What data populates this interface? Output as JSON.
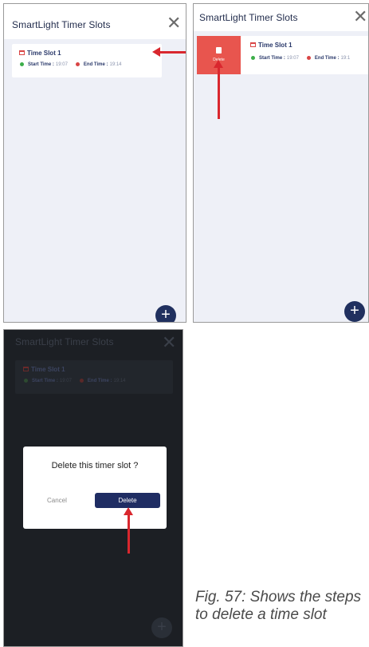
{
  "panel1": {
    "title": "SmartLight Timer Slots",
    "slot_title": "Time Slot 1",
    "start_label": "Start Time :",
    "start_value": "19:07",
    "end_label": "End Time :",
    "end_value": "19:14",
    "fab": "+"
  },
  "panel2": {
    "title": "SmartLight Timer Slots",
    "delete_label": "Delete",
    "slot_title": "Time Slot 1",
    "start_label": "Start Time :",
    "start_value": "19:07",
    "end_label": "End Time :",
    "end_value": "19:1",
    "fab": "+"
  },
  "panel3": {
    "title": "SmartLight Timer Slots",
    "slot_title": "Time Slot 1",
    "start_label": "Start Time :",
    "start_value": "19:07",
    "end_label": "End Time :",
    "end_value": "19:14",
    "dialog_question": "Delete this timer slot ?",
    "cancel_label": "Cancel",
    "delete_label": "Delete",
    "fab": "+"
  },
  "caption": "Fig. 57: Shows the steps to delete a time slot",
  "colors": {
    "accent": "#20305f",
    "delete": "#e8554e",
    "arrow": "#d9272e",
    "start_dot": "#3cae49",
    "end_dot": "#d94545"
  },
  "icons": [
    "close-icon",
    "calendar-icon",
    "trash-icon",
    "plus-icon",
    "arrow-icon"
  ]
}
